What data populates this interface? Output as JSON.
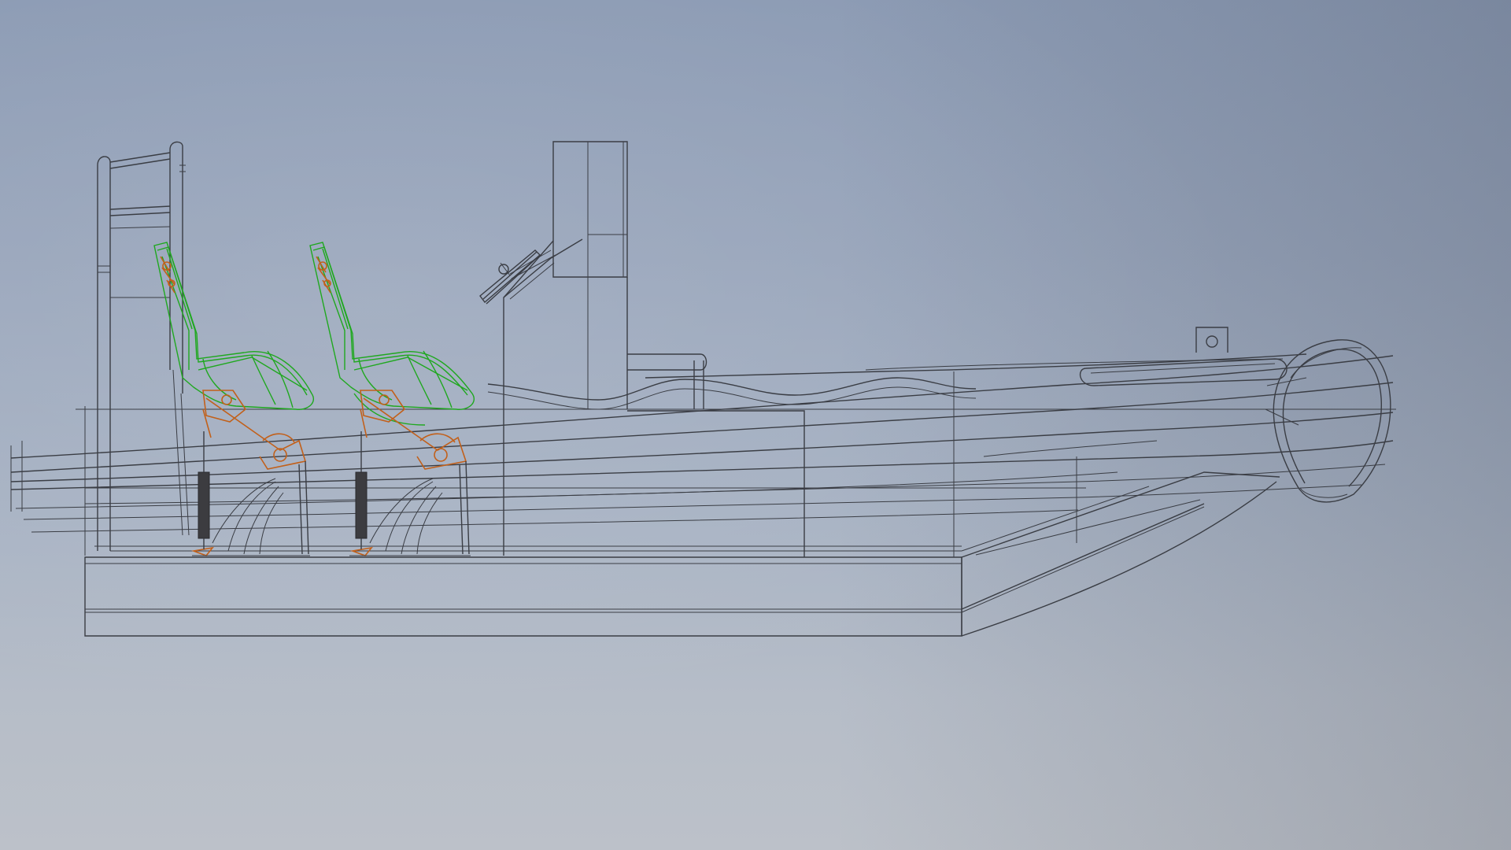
{
  "view": {
    "background_top": "#8c9bb4",
    "background_bottom": "#bcc1c9",
    "wire_color": "#3a3d44",
    "seat_color": "#1fa81f",
    "bracket_color": "#c2601a"
  },
  "model": {
    "parts": [
      {
        "name": "hull",
        "icon": "hull-wireframe"
      },
      {
        "name": "deck",
        "icon": "deck-wireframe"
      },
      {
        "name": "tubes",
        "icon": "tube-wireframe"
      },
      {
        "name": "console",
        "icon": "console-wireframe"
      },
      {
        "name": "steering-wheel",
        "icon": "wheel-wireframe"
      },
      {
        "name": "seat-rear",
        "icon": "seat-wireframe"
      },
      {
        "name": "seat-front",
        "icon": "seat-wireframe"
      },
      {
        "name": "seat-suspension-rear",
        "icon": "suspension-wireframe"
      },
      {
        "name": "seat-suspension-front",
        "icon": "suspension-wireframe"
      },
      {
        "name": "stern-frame",
        "icon": "frame-wireframe"
      },
      {
        "name": "bow-ring",
        "icon": "bow-wireframe"
      }
    ]
  }
}
